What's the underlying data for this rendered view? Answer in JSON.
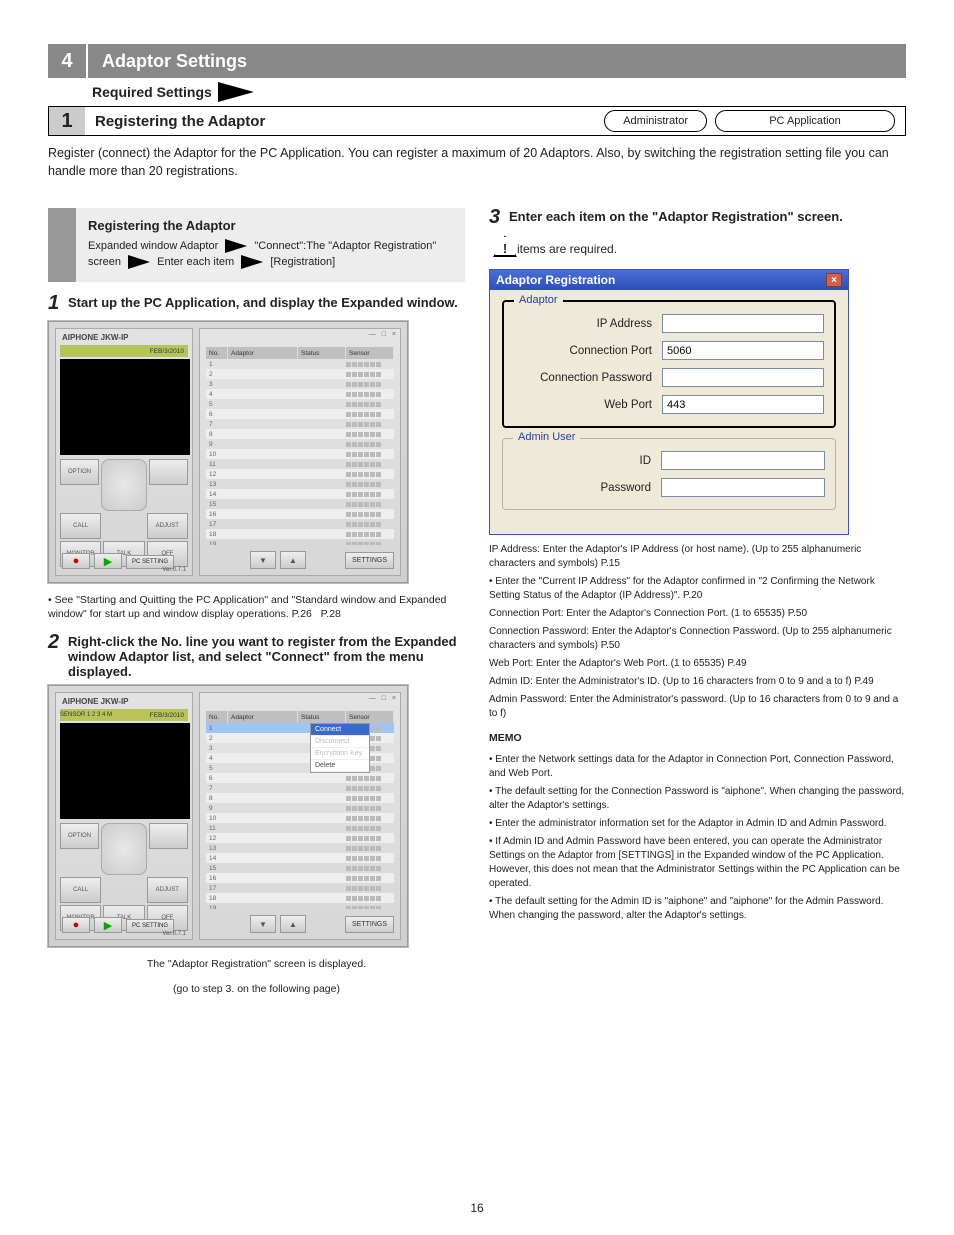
{
  "section": {
    "number": "4",
    "title": "Adaptor Settings",
    "required_label": "Required Settings"
  },
  "step_bar": {
    "number": "1",
    "label": "Registering the Adaptor",
    "pill1": "Administrator",
    "pill2": "PC Application"
  },
  "intro_para": "Register (connect) the Adaptor for the PC Application. You can register a maximum of 20 Adaptors. Also, by switching the registration setting file you can handle more than 20 registrations.",
  "proc": {
    "title": "Registering the Adaptor",
    "line2_l": "Expanded window Adaptor",
    "line2_r": "\"Connect\":The \"Adaptor Registration\" screen",
    "line3": "Enter each item",
    "line4": "[Registration]"
  },
  "left": {
    "step1": {
      "n": "1",
      "t": "Start up the PC Application, and display the Expanded window."
    },
    "note1": "• See \"Starting and Quitting the PC Application\" and \"Standard window and Expanded window\" for start up and window display operations.",
    "p_26": "P.26",
    "p_28": "P.28",
    "step2": {
      "n": "2",
      "t": "Right-click the No. line you want to register from the Expanded window Adaptor list, and select \"Connect\" from the menu displayed."
    },
    "afterstep2": "The \"Adaptor Registration\" screen is displayed.",
    "step3_center": "(go to step 3. on the following page)"
  },
  "right": {
    "step3": {
      "n": "3",
      "t": "Enter each item on the \"Adaptor Registration\" screen."
    },
    "step3_after": "  items are required.",
    "dlg": {
      "title": "Adaptor Registration",
      "group1": "Adaptor",
      "group2": "Admin User",
      "ip_label": "IP Address",
      "ip_value": "",
      "port_label": "Connection Port",
      "port_value": "5060",
      "pw_label": "Connection Password",
      "pw_value": "",
      "web_label": "Web Port",
      "web_value": "443",
      "id_label": "ID",
      "id_value": "",
      "apw_label": "Password",
      "apw_value": ""
    },
    "desc": [
      "IP Address: Enter the Adaptor's IP Address (or host name). (Up to 255 alphanumeric characters and symbols)",
      "• Enter the \"Current IP Address\" for the Adaptor confirmed in \"2 Confirming the Network Setting Status of the Adaptor (IP Address)\".",
      "Connection Port: Enter the Adaptor's Connection Port. (1 to 65535)",
      "Connection Password: Enter the Adaptor's Connection Password. (Up to 255 alphanumeric characters and symbols)",
      "Web Port: Enter the Adaptor's Web Port. (1 to 65535)",
      "Admin ID: Enter the Administrator's ID. (Up to 16 characters from 0 to 9 and a to f)",
      "Admin Password: Enter the Administrator's password. (Up to 16 characters from 0 to 9 and a to f)"
    ],
    "memo_label": "MEMO",
    "memo": [
      "• Enter the Network settings data for the Adaptor in Connection Port, Connection Password, and Web Port.",
      "• The default setting for the Connection Password is \"aiphone\". When changing the password, alter the Adaptor's settings.",
      "• Enter the administrator information set for the Adaptor in Admin ID and Admin Password.",
      "• If Admin ID and Admin Password have been entered, you can operate the Administrator Settings on the Adaptor from [SETTINGS] in the Expanded window of the PC Application. However, this does not mean that the Administrator Settings within the PC Application can be operated.",
      "• The default setting for the Admin ID is \"aiphone\" and \"aiphone\" for the Admin Password. When changing the password, alter the Adaptor's settings."
    ],
    "refs": [
      "P.15",
      "P.20",
      "P.50",
      "P.50",
      "P.49",
      "P.49"
    ]
  },
  "app": {
    "brand": "AIPHONE JKW-IP",
    "status_sensor": "SENSOR   1  2  3  4  M",
    "status_date": "FEB/3/2010",
    "btns": {
      "option": "OPTION",
      "key": "",
      "call": "CALL",
      "adj": "ADJUST",
      "mon": "MONITOR",
      "talk": "TALK",
      "off": "OFF",
      "pcset": "PC SETTING"
    },
    "ver": "Ver.0.7.1",
    "winbtns": "— □ ×",
    "headers": {
      "no": "No.",
      "adaptor": "Adaptor",
      "status": "Status",
      "sensor": "Sensor"
    },
    "settings_btn": "SETTINGS",
    "ctx": {
      "connect": "Connect",
      "disconnect": "Disconnect",
      "encrypt": "Encryption Key",
      "delete": "Delete"
    }
  },
  "pagenum": "16"
}
